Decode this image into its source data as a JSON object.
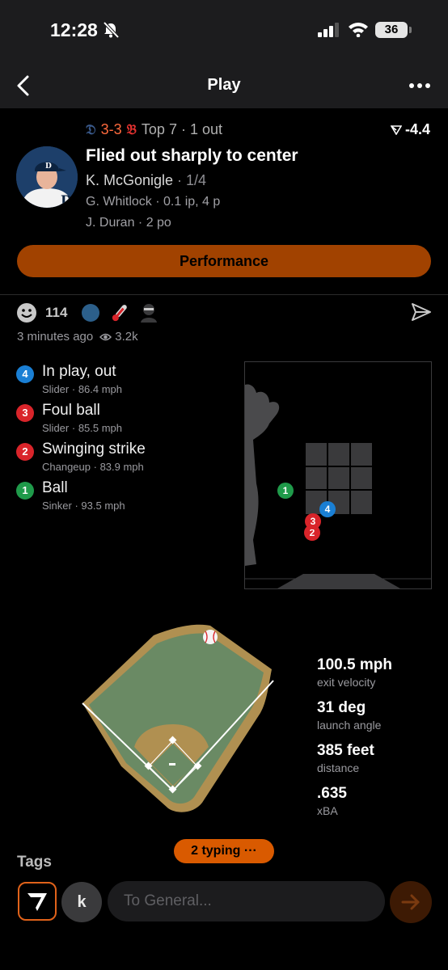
{
  "status": {
    "time": "12:28",
    "battery": "36"
  },
  "nav": {
    "title": "Play"
  },
  "play": {
    "score": "3-3",
    "inning": "Top 7 · 1 out",
    "wpa": "-4.4",
    "title": "Flied out sharply to center",
    "batter_name": "K. McGonigle",
    "batter_line": " · 1/4",
    "pitcher": "G. Whitlock · 0.1 ip, 4 p",
    "fielder": "J. Duran · 2 po",
    "performance_label": "Performance"
  },
  "social": {
    "reaction_count": "114",
    "time_ago": "3 minutes ago",
    "views": "3.2k"
  },
  "pitches": [
    {
      "num": "4",
      "result": "In play, out",
      "type": "Slider",
      "speed": "86.4 mph",
      "color": "#1a7fd4"
    },
    {
      "num": "3",
      "result": "Foul ball",
      "type": "Slider",
      "speed": "85.5 mph",
      "color": "#d9242a"
    },
    {
      "num": "2",
      "result": "Swinging strike",
      "type": "Changeup",
      "speed": "83.9 mph",
      "color": "#d9242a"
    },
    {
      "num": "1",
      "result": "Ball",
      "type": "Sinker",
      "speed": "93.5 mph",
      "color": "#1f9a4a"
    }
  ],
  "batted_ball": {
    "exit_velocity": "100.5 mph",
    "exit_velocity_label": "exit velocity",
    "launch_angle": "31 deg",
    "launch_angle_label": "launch angle",
    "distance": "385 feet",
    "distance_label": "distance",
    "xba": ".635",
    "xba_label": "xBA"
  },
  "tags": {
    "title": "Tags"
  },
  "typing": {
    "label": "2 typing ···"
  },
  "composer": {
    "avatar_letter": "k",
    "placeholder": "To General..."
  },
  "icons": [
    "chevron-left-icon",
    "more-icon",
    "smile-icon",
    "thermometer-icon",
    "send-icon",
    "eye-icon",
    "arrow-right-icon"
  ]
}
